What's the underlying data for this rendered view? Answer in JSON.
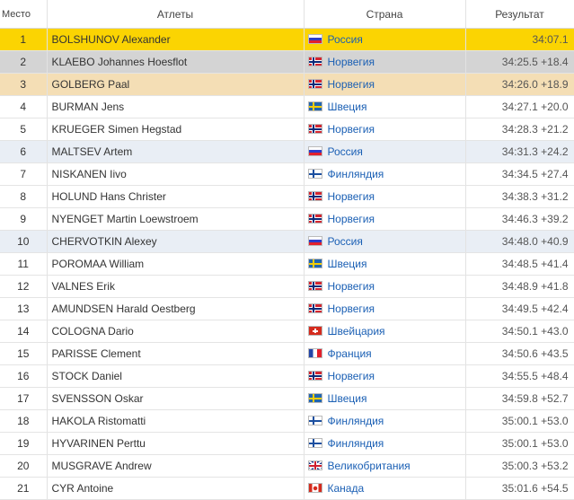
{
  "header": {
    "place": "Место",
    "athletes": "Атлеты",
    "country": "Страна",
    "result": "Результат"
  },
  "rows": [
    {
      "place": "1",
      "athlete": "BOLSHUNOV Alexander",
      "flag": "ru",
      "country": "Россия",
      "result": "34:07.1"
    },
    {
      "place": "2",
      "athlete": "KLAEBO Johannes Hoesflot",
      "flag": "no",
      "country": "Норвегия",
      "result": "34:25.5 +18.4"
    },
    {
      "place": "3",
      "athlete": "GOLBERG Paal",
      "flag": "no",
      "country": "Норвегия",
      "result": "34:26.0 +18.9"
    },
    {
      "place": "4",
      "athlete": "BURMAN Jens",
      "flag": "se",
      "country": "Швеция",
      "result": "34:27.1 +20.0"
    },
    {
      "place": "5",
      "athlete": "KRUEGER Simen Hegstad",
      "flag": "no",
      "country": "Норвегия",
      "result": "34:28.3 +21.2"
    },
    {
      "place": "6",
      "athlete": "MALTSEV Artem",
      "flag": "ru",
      "country": "Россия",
      "result": "34:31.3 +24.2"
    },
    {
      "place": "7",
      "athlete": "NISKANEN Iivo",
      "flag": "fi",
      "country": "Финляндия",
      "result": "34:34.5 +27.4"
    },
    {
      "place": "8",
      "athlete": "HOLUND Hans Christer",
      "flag": "no",
      "country": "Норвегия",
      "result": "34:38.3 +31.2"
    },
    {
      "place": "9",
      "athlete": "NYENGET Martin Loewstroem",
      "flag": "no",
      "country": "Норвегия",
      "result": "34:46.3 +39.2"
    },
    {
      "place": "10",
      "athlete": "CHERVOTKIN Alexey",
      "flag": "ru",
      "country": "Россия",
      "result": "34:48.0 +40.9"
    },
    {
      "place": "11",
      "athlete": "POROMAA William",
      "flag": "se",
      "country": "Швеция",
      "result": "34:48.5 +41.4"
    },
    {
      "place": "12",
      "athlete": "VALNES Erik",
      "flag": "no",
      "country": "Норвегия",
      "result": "34:48.9 +41.8"
    },
    {
      "place": "13",
      "athlete": "AMUNDSEN Harald Oestberg",
      "flag": "no",
      "country": "Норвегия",
      "result": "34:49.5 +42.4"
    },
    {
      "place": "14",
      "athlete": "COLOGNA Dario",
      "flag": "ch",
      "country": "Швейцария",
      "result": "34:50.1 +43.0"
    },
    {
      "place": "15",
      "athlete": "PARISSE Clement",
      "flag": "fr",
      "country": "Франция",
      "result": "34:50.6 +43.5"
    },
    {
      "place": "16",
      "athlete": "STOCK Daniel",
      "flag": "no",
      "country": "Норвегия",
      "result": "34:55.5 +48.4"
    },
    {
      "place": "17",
      "athlete": "SVENSSON Oskar",
      "flag": "se",
      "country": "Швеция",
      "result": "34:59.8 +52.7"
    },
    {
      "place": "18",
      "athlete": "HAKOLA Ristomatti",
      "flag": "fi",
      "country": "Финляндия",
      "result": "35:00.1 +53.0"
    },
    {
      "place": "19",
      "athlete": "HYVARINEN Perttu",
      "flag": "fi",
      "country": "Финляндия",
      "result": "35:00.1 +53.0"
    },
    {
      "place": "20",
      "athlete": "MUSGRAVE Andrew",
      "flag": "gb",
      "country": "Великобритания",
      "result": "35:00.3 +53.2"
    },
    {
      "place": "21",
      "athlete": "CYR Antoine",
      "flag": "ca",
      "country": "Канада",
      "result": "35:01.6 +54.5"
    }
  ],
  "colors": {
    "gold": "#fbd402",
    "silver": "#d4d4d4",
    "bronze": "#f4deb5",
    "highlight": "#e9eef5",
    "link": "#1a5fb4"
  }
}
